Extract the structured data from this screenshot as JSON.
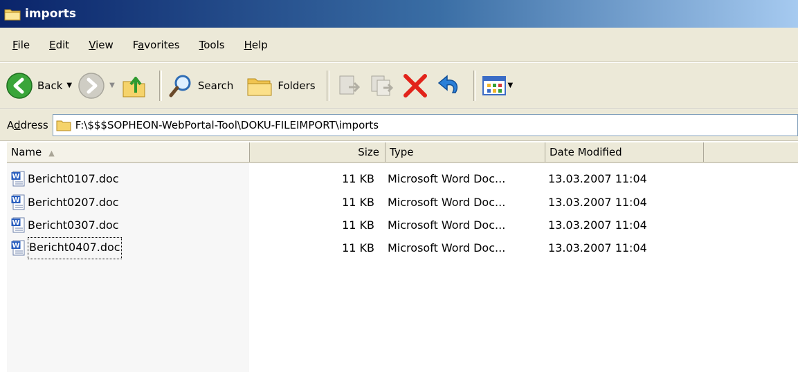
{
  "window": {
    "title": "imports",
    "icon": "folder-icon"
  },
  "menu": {
    "items": [
      {
        "label_first": "F",
        "label_rest": "ile"
      },
      {
        "label_first": "E",
        "label_rest": "dit"
      },
      {
        "label_first": "V",
        "label_rest": "iew"
      },
      {
        "label_pre": "F",
        "label_first": "a",
        "label_rest": "vorites"
      },
      {
        "label_first": "T",
        "label_rest": "ools"
      },
      {
        "label_first": "H",
        "label_rest": "elp"
      }
    ]
  },
  "toolbar": {
    "back_label": "Back",
    "search_label": "Search",
    "folders_label": "Folders"
  },
  "address": {
    "label_pre": "A",
    "label_first": "d",
    "label_rest": "dress",
    "path": "F:\\$$$SOPHEON-WebPortal-Tool\\DOKU-FILEIMPORT\\imports"
  },
  "columns": {
    "name": "Name",
    "size": "Size",
    "type": "Type",
    "date": "Date Modified"
  },
  "files": [
    {
      "name": "Bericht0107.doc",
      "size": "11 KB",
      "type": "Microsoft Word Doc...",
      "date": "13.03.2007 11:04"
    },
    {
      "name": "Bericht0207.doc",
      "size": "11 KB",
      "type": "Microsoft Word Doc...",
      "date": "13.03.2007 11:04"
    },
    {
      "name": "Bericht0307.doc",
      "size": "11 KB",
      "type": "Microsoft Word Doc...",
      "date": "13.03.2007 11:04"
    },
    {
      "name": "Bericht0407.doc",
      "size": "11 KB",
      "type": "Microsoft Word Doc...",
      "date": "13.03.2007 11:04"
    }
  ],
  "colors": {
    "titlebar_start": "#0a246a",
    "chrome": "#ece9d8",
    "delete_red": "#e2231a"
  }
}
